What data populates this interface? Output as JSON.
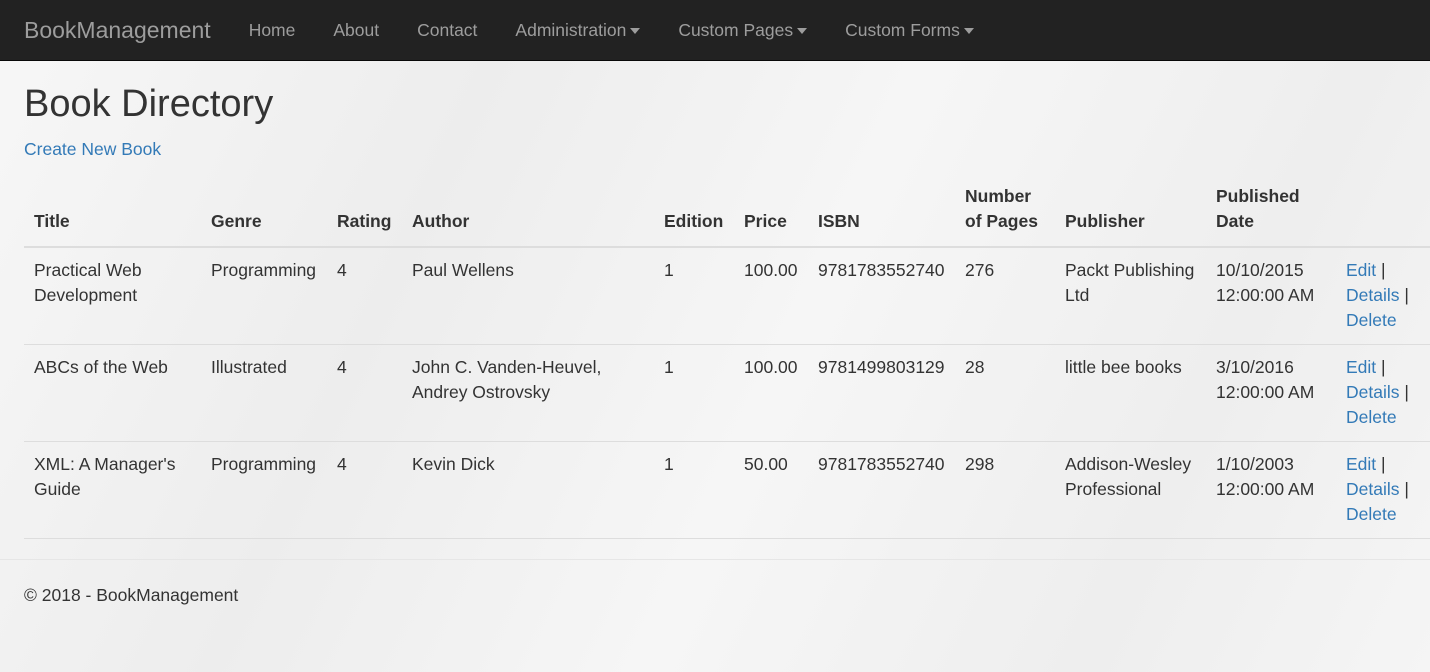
{
  "nav": {
    "brand": "BookManagement",
    "items": [
      {
        "label": "Home",
        "dropdown": false
      },
      {
        "label": "About",
        "dropdown": false
      },
      {
        "label": "Contact",
        "dropdown": false
      },
      {
        "label": "Administration",
        "dropdown": true
      },
      {
        "label": "Custom Pages",
        "dropdown": true
      },
      {
        "label": "Custom Forms",
        "dropdown": true
      }
    ]
  },
  "page": {
    "title": "Book Directory",
    "create_link": "Create New Book"
  },
  "table": {
    "headers": [
      "Title",
      "Genre",
      "Rating",
      "Author",
      "Edition",
      "Price",
      "ISBN",
      "Number of Pages",
      "Publisher",
      "Published Date"
    ],
    "actions": {
      "edit": "Edit",
      "details": "Details",
      "delete": "Delete",
      "separator": "|"
    },
    "rows": [
      {
        "title": "Practical Web Development",
        "genre": "Programming",
        "rating": "4",
        "author": "Paul Wellens",
        "edition": "1",
        "price": "100.00",
        "isbn": "9781783552740",
        "pages": "276",
        "publisher": "Packt Publishing Ltd",
        "published": "10/10/2015 12:00:00 AM"
      },
      {
        "title": "ABCs of the Web",
        "genre": "Illustrated",
        "rating": "4",
        "author": "John C. Vanden-Heuvel, Andrey Ostrovsky",
        "edition": "1",
        "price": "100.00",
        "isbn": "9781499803129",
        "pages": "28",
        "publisher": "little bee books",
        "published": "3/10/2016 12:00:00 AM"
      },
      {
        "title": "XML: A Manager's Guide",
        "genre": "Programming",
        "rating": "4",
        "author": "Kevin Dick",
        "edition": "1",
        "price": "50.00",
        "isbn": "9781783552740",
        "pages": "298",
        "publisher": "Addison-Wesley Professional",
        "published": "1/10/2003 12:00:00 AM"
      }
    ]
  },
  "footer": {
    "text": "© 2018 - BookManagement"
  }
}
